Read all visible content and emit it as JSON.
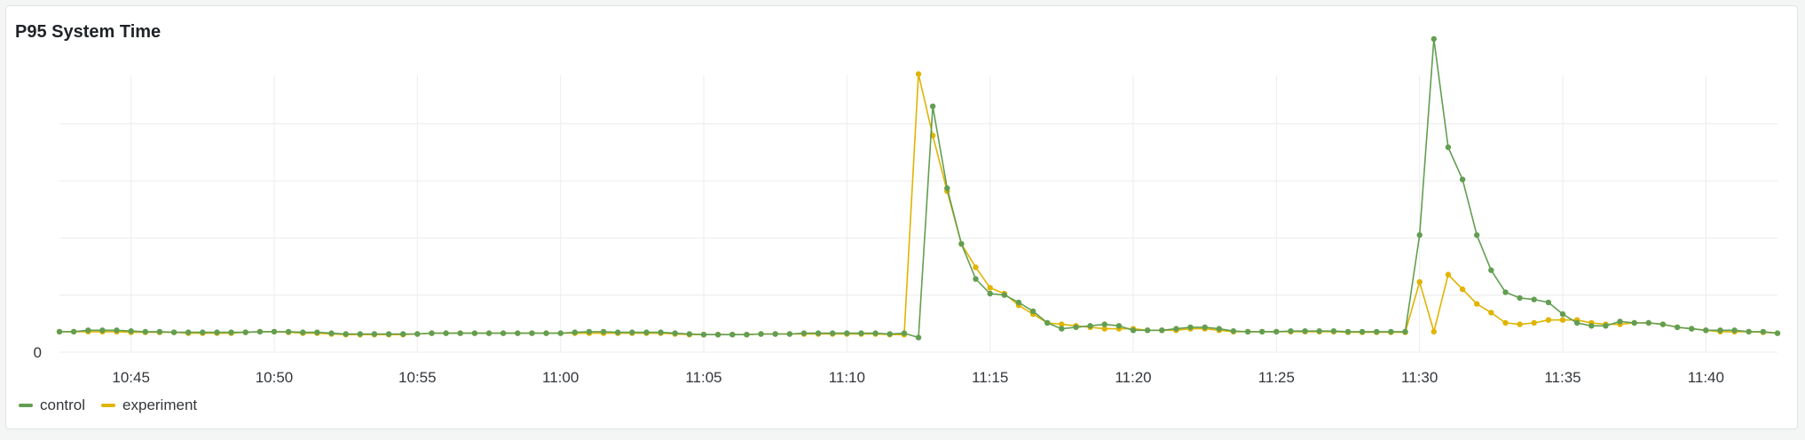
{
  "panel": {
    "title": "P95 System Time"
  },
  "colors": {
    "control": "#629e51",
    "experiment": "#e0b400",
    "grid": "#ececec",
    "axis_text": "#33363b"
  },
  "chart_data": {
    "type": "line",
    "title": "P95 System Time",
    "xlabel": "",
    "ylabel": "",
    "x_ticks": [
      "10:45",
      "10:50",
      "10:55",
      "11:00",
      "11:05",
      "11:10",
      "11:15",
      "11:20",
      "11:25",
      "11:30",
      "11:35",
      "11:40"
    ],
    "y_ticks": [
      "0"
    ],
    "x_range": [
      "10:42:30",
      "11:42:30"
    ],
    "ylim": [
      0,
      100
    ],
    "grid": true,
    "legend_position": "bottom-left",
    "series": [
      {
        "name": "control",
        "points": [
          [
            "10:42:30",
            7.0
          ],
          [
            "10:43:00",
            7.0
          ],
          [
            "10:43:30",
            7.5
          ],
          [
            "10:44:00",
            7.5
          ],
          [
            "10:44:30",
            7.5
          ],
          [
            "10:45:00",
            7.2
          ],
          [
            "10:45:30",
            7.0
          ],
          [
            "10:46:00",
            7.0
          ],
          [
            "10:46:30",
            6.8
          ],
          [
            "10:47:00",
            6.8
          ],
          [
            "10:47:30",
            6.8
          ],
          [
            "10:48:00",
            6.8
          ],
          [
            "10:48:30",
            6.8
          ],
          [
            "10:49:00",
            6.8
          ],
          [
            "10:49:30",
            7.0
          ],
          [
            "10:50:00",
            7.0
          ],
          [
            "10:50:30",
            7.0
          ],
          [
            "10:51:00",
            6.8
          ],
          [
            "10:51:30",
            6.8
          ],
          [
            "10:52:00",
            6.5
          ],
          [
            "10:52:30",
            6.2
          ],
          [
            "10:53:00",
            6.2
          ],
          [
            "10:53:30",
            6.2
          ],
          [
            "10:54:00",
            6.2
          ],
          [
            "10:54:30",
            6.2
          ],
          [
            "10:55:00",
            6.2
          ],
          [
            "10:55:30",
            6.5
          ],
          [
            "10:56:00",
            6.5
          ],
          [
            "10:56:30",
            6.5
          ],
          [
            "10:57:00",
            6.5
          ],
          [
            "10:57:30",
            6.5
          ],
          [
            "10:58:00",
            6.5
          ],
          [
            "10:58:30",
            6.5
          ],
          [
            "10:59:00",
            6.5
          ],
          [
            "10:59:30",
            6.5
          ],
          [
            "11:00:00",
            6.5
          ],
          [
            "11:00:30",
            6.8
          ],
          [
            "11:01:00",
            7.0
          ],
          [
            "11:01:30",
            7.0
          ],
          [
            "11:02:00",
            6.8
          ],
          [
            "11:02:30",
            6.8
          ],
          [
            "11:03:00",
            6.8
          ],
          [
            "11:03:30",
            6.8
          ],
          [
            "11:04:00",
            6.5
          ],
          [
            "11:04:30",
            6.2
          ],
          [
            "11:05:00",
            6.0
          ],
          [
            "11:05:30",
            6.0
          ],
          [
            "11:06:00",
            6.0
          ],
          [
            "11:06:30",
            6.0
          ],
          [
            "11:07:00",
            6.2
          ],
          [
            "11:07:30",
            6.2
          ],
          [
            "11:08:00",
            6.2
          ],
          [
            "11:08:30",
            6.5
          ],
          [
            "11:09:00",
            6.5
          ],
          [
            "11:09:30",
            6.5
          ],
          [
            "11:10:00",
            6.5
          ],
          [
            "11:10:30",
            6.5
          ],
          [
            "11:11:00",
            6.5
          ],
          [
            "11:11:30",
            6.2
          ],
          [
            "11:12:00",
            6.5
          ],
          [
            "11:12:30",
            5.0
          ],
          [
            "11:13:00",
            84.0
          ],
          [
            "11:13:30",
            56.0
          ],
          [
            "11:14:00",
            37.0
          ],
          [
            "11:14:30",
            25.0
          ],
          [
            "11:15:00",
            20.0
          ],
          [
            "11:15:30",
            19.5
          ],
          [
            "11:16:00",
            17.0
          ],
          [
            "11:16:30",
            14.0
          ],
          [
            "11:17:00",
            10.0
          ],
          [
            "11:17:30",
            8.0
          ],
          [
            "11:18:00",
            8.5
          ],
          [
            "11:18:30",
            9.0
          ],
          [
            "11:19:00",
            9.5
          ],
          [
            "11:19:30",
            9.0
          ],
          [
            "11:20:00",
            7.5
          ],
          [
            "11:20:30",
            7.5
          ],
          [
            "11:21:00",
            7.5
          ],
          [
            "11:21:30",
            8.0
          ],
          [
            "11:22:00",
            8.5
          ],
          [
            "11:22:30",
            8.5
          ],
          [
            "11:23:00",
            8.0
          ],
          [
            "11:23:30",
            7.2
          ],
          [
            "11:24:00",
            7.0
          ],
          [
            "11:24:30",
            7.0
          ],
          [
            "11:25:00",
            7.0
          ],
          [
            "11:25:30",
            7.2
          ],
          [
            "11:26:00",
            7.2
          ],
          [
            "11:26:30",
            7.2
          ],
          [
            "11:27:00",
            7.2
          ],
          [
            "11:27:30",
            7.0
          ],
          [
            "11:28:00",
            7.0
          ],
          [
            "11:28:30",
            7.0
          ],
          [
            "11:29:00",
            7.0
          ],
          [
            "11:29:30",
            7.0
          ],
          [
            "11:30:00",
            40.0
          ],
          [
            "11:30:30",
            107.0
          ],
          [
            "11:31:00",
            70.0
          ],
          [
            "11:31:30",
            59.0
          ],
          [
            "11:32:00",
            40.0
          ],
          [
            "11:32:30",
            28.0
          ],
          [
            "11:33:00",
            20.5
          ],
          [
            "11:33:30",
            18.5
          ],
          [
            "11:34:00",
            18.0
          ],
          [
            "11:34:30",
            17.0
          ],
          [
            "11:35:00",
            13.0
          ],
          [
            "11:35:30",
            10.0
          ],
          [
            "11:36:00",
            9.0
          ],
          [
            "11:36:30",
            9.0
          ],
          [
            "11:37:00",
            10.5
          ],
          [
            "11:37:30",
            10.0
          ],
          [
            "11:38:00",
            10.0
          ],
          [
            "11:38:30",
            9.5
          ],
          [
            "11:39:00",
            8.5
          ],
          [
            "11:39:30",
            8.0
          ],
          [
            "11:40:00",
            7.5
          ],
          [
            "11:40:30",
            7.5
          ],
          [
            "11:41:00",
            7.5
          ],
          [
            "11:41:30",
            7.0
          ],
          [
            "11:42:00",
            7.0
          ],
          [
            "11:42:30",
            6.5
          ]
        ]
      },
      {
        "name": "experiment",
        "points": [
          [
            "10:42:30",
            7.0
          ],
          [
            "10:43:00",
            7.0
          ],
          [
            "10:43:30",
            7.0
          ],
          [
            "10:44:00",
            7.0
          ],
          [
            "10:44:30",
            7.0
          ],
          [
            "10:45:00",
            6.8
          ],
          [
            "10:45:30",
            6.8
          ],
          [
            "10:46:00",
            6.8
          ],
          [
            "10:46:30",
            6.8
          ],
          [
            "10:47:00",
            6.5
          ],
          [
            "10:47:30",
            6.5
          ],
          [
            "10:48:00",
            6.5
          ],
          [
            "10:48:30",
            6.5
          ],
          [
            "10:49:00",
            6.8
          ],
          [
            "10:49:30",
            7.0
          ],
          [
            "10:50:00",
            7.0
          ],
          [
            "10:50:30",
            6.8
          ],
          [
            "10:51:00",
            6.5
          ],
          [
            "10:51:30",
            6.5
          ],
          [
            "10:52:00",
            6.2
          ],
          [
            "10:52:30",
            6.0
          ],
          [
            "10:53:00",
            6.0
          ],
          [
            "10:53:30",
            6.0
          ],
          [
            "10:54:00",
            6.0
          ],
          [
            "10:54:30",
            6.0
          ],
          [
            "10:55:00",
            6.2
          ],
          [
            "10:55:30",
            6.5
          ],
          [
            "10:56:00",
            6.5
          ],
          [
            "10:56:30",
            6.5
          ],
          [
            "10:57:00",
            6.5
          ],
          [
            "10:57:30",
            6.5
          ],
          [
            "10:58:00",
            6.5
          ],
          [
            "10:58:30",
            6.5
          ],
          [
            "10:59:00",
            6.5
          ],
          [
            "10:59:30",
            6.5
          ],
          [
            "11:00:00",
            6.5
          ],
          [
            "11:00:30",
            6.5
          ],
          [
            "11:01:00",
            6.5
          ],
          [
            "11:01:30",
            6.5
          ],
          [
            "11:02:00",
            6.5
          ],
          [
            "11:02:30",
            6.5
          ],
          [
            "11:03:00",
            6.5
          ],
          [
            "11:03:30",
            6.5
          ],
          [
            "11:04:00",
            6.2
          ],
          [
            "11:04:30",
            6.0
          ],
          [
            "11:05:00",
            6.0
          ],
          [
            "11:05:30",
            6.0
          ],
          [
            "11:06:00",
            6.0
          ],
          [
            "11:06:30",
            6.0
          ],
          [
            "11:07:00",
            6.2
          ],
          [
            "11:07:30",
            6.2
          ],
          [
            "11:08:00",
            6.2
          ],
          [
            "11:08:30",
            6.2
          ],
          [
            "11:09:00",
            6.2
          ],
          [
            "11:09:30",
            6.2
          ],
          [
            "11:10:00",
            6.2
          ],
          [
            "11:10:30",
            6.2
          ],
          [
            "11:11:00",
            6.2
          ],
          [
            "11:11:30",
            6.0
          ],
          [
            "11:12:00",
            6.0
          ],
          [
            "11:12:30",
            95.0
          ],
          [
            "11:13:00",
            74.0
          ],
          [
            "11:13:30",
            55.0
          ],
          [
            "11:14:00",
            37.0
          ],
          [
            "11:14:30",
            29.0
          ],
          [
            "11:15:00",
            22.0
          ],
          [
            "11:15:30",
            20.0
          ],
          [
            "11:16:00",
            16.0
          ],
          [
            "11:16:30",
            13.0
          ],
          [
            "11:17:00",
            10.0
          ],
          [
            "11:17:30",
            9.5
          ],
          [
            "11:18:00",
            9.0
          ],
          [
            "11:18:30",
            8.5
          ],
          [
            "11:19:00",
            8.0
          ],
          [
            "11:19:30",
            8.0
          ],
          [
            "11:20:00",
            8.0
          ],
          [
            "11:20:30",
            7.5
          ],
          [
            "11:21:00",
            7.5
          ],
          [
            "11:21:30",
            7.5
          ],
          [
            "11:22:00",
            8.0
          ],
          [
            "11:22:30",
            8.0
          ],
          [
            "11:23:00",
            7.5
          ],
          [
            "11:23:30",
            7.0
          ],
          [
            "11:24:00",
            7.0
          ],
          [
            "11:24:30",
            7.0
          ],
          [
            "11:25:00",
            7.0
          ],
          [
            "11:25:30",
            7.0
          ],
          [
            "11:26:00",
            7.0
          ],
          [
            "11:26:30",
            7.0
          ],
          [
            "11:27:00",
            7.0
          ],
          [
            "11:27:30",
            6.8
          ],
          [
            "11:28:00",
            6.8
          ],
          [
            "11:28:30",
            6.8
          ],
          [
            "11:29:00",
            6.8
          ],
          [
            "11:29:30",
            6.8
          ],
          [
            "11:30:00",
            24.0
          ],
          [
            "11:30:30",
            7.0
          ],
          [
            "11:31:00",
            26.5
          ],
          [
            "11:31:30",
            21.5
          ],
          [
            "11:32:00",
            16.5
          ],
          [
            "11:32:30",
            13.5
          ],
          [
            "11:33:00",
            10.0
          ],
          [
            "11:33:30",
            9.5
          ],
          [
            "11:34:00",
            10.0
          ],
          [
            "11:34:30",
            11.0
          ],
          [
            "11:35:00",
            11.0
          ],
          [
            "11:35:30",
            11.0
          ],
          [
            "11:36:00",
            10.0
          ],
          [
            "11:36:30",
            9.5
          ],
          [
            "11:37:00",
            9.5
          ],
          [
            "11:37:30",
            10.0
          ],
          [
            "11:38:00",
            10.0
          ],
          [
            "11:38:30",
            9.5
          ],
          [
            "11:39:00",
            8.5
          ],
          [
            "11:39:30",
            8.0
          ],
          [
            "11:40:00",
            7.5
          ],
          [
            "11:40:30",
            7.0
          ],
          [
            "11:41:00",
            7.0
          ],
          [
            "11:41:30",
            7.0
          ],
          [
            "11:42:00",
            6.8
          ],
          [
            "11:42:30",
            6.5
          ]
        ]
      }
    ]
  },
  "legend": {
    "items": [
      {
        "label": "control",
        "color": "#629e51"
      },
      {
        "label": "experiment",
        "color": "#e0b400"
      }
    ]
  }
}
